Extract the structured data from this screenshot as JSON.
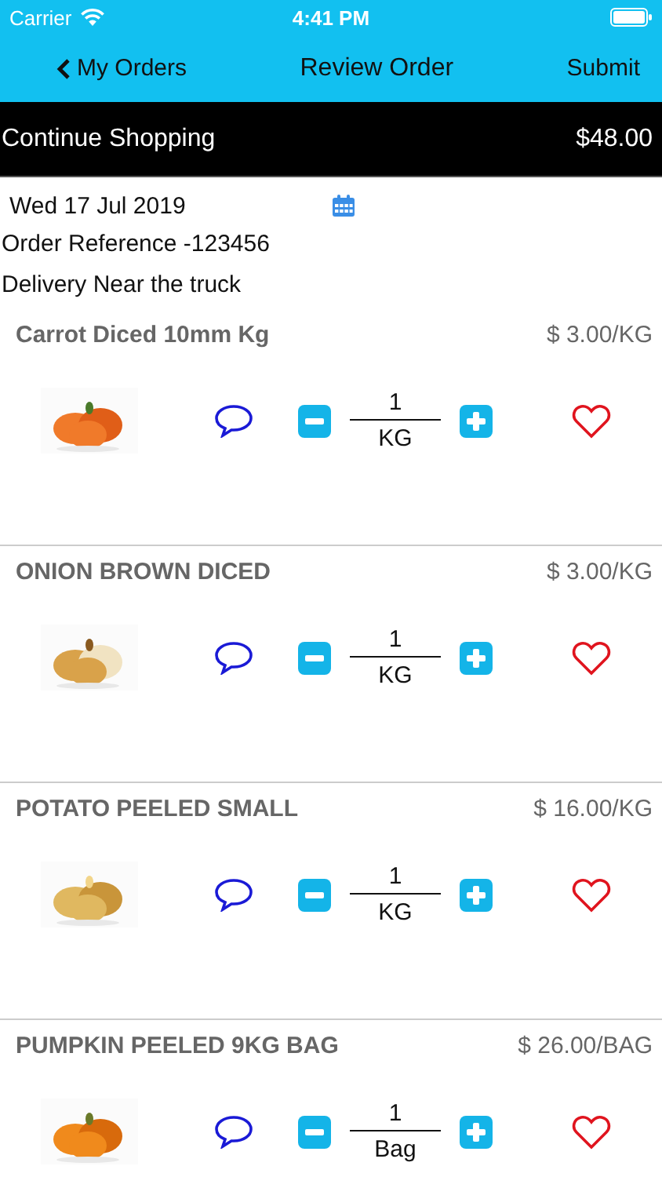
{
  "status_bar": {
    "carrier": "Carrier",
    "time": "4:41 PM"
  },
  "nav": {
    "back": "My Orders",
    "title": "Review Order",
    "action": "Submit"
  },
  "cart_bar": {
    "label": "Continue Shopping",
    "total": "$48.00"
  },
  "order": {
    "date": "Wed 17 Jul 2019",
    "reference": "Order Reference -123456",
    "delivery": "Delivery Near the truck"
  },
  "items": [
    {
      "name": "Carrot Diced 10mm Kg",
      "price": "$ 3.00/KG",
      "quantity": "1",
      "unit": "KG"
    },
    {
      "name": "ONION BROWN DICED",
      "price": "$ 3.00/KG",
      "quantity": "1",
      "unit": "KG"
    },
    {
      "name": "POTATO PEELED SMALL",
      "price": "$ 16.00/KG",
      "quantity": "1",
      "unit": "KG"
    },
    {
      "name": "PUMPKIN PEELED 9KG BAG",
      "price": "$ 26.00/BAG",
      "quantity": "1",
      "unit": "Bag"
    }
  ]
}
